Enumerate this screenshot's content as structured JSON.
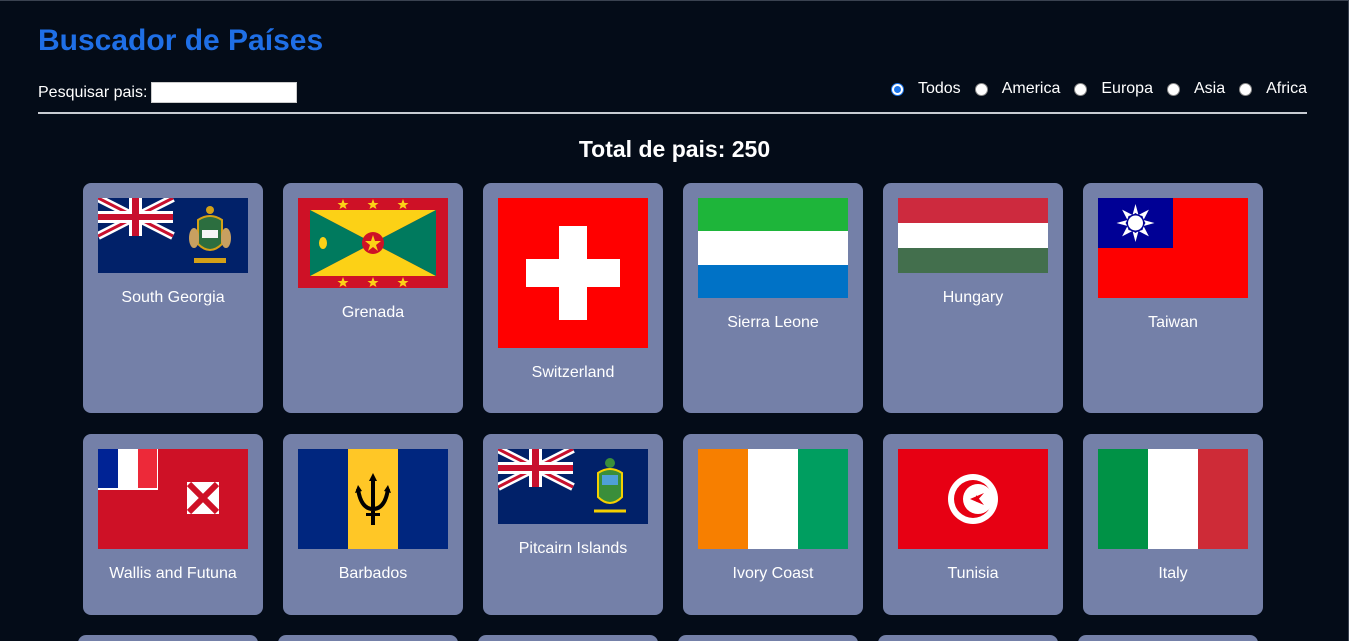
{
  "header": {
    "title": "Buscador de Países"
  },
  "search": {
    "label": "Pesquisar pais:",
    "value": "",
    "placeholder": ""
  },
  "filters": {
    "selected": "Todos",
    "options": [
      "Todos",
      "America",
      "Europa",
      "Asia",
      "Africa"
    ]
  },
  "total": {
    "text": "Total de pais: 250"
  },
  "countries": [
    {
      "name": "South Georgia",
      "flag": "south-georgia-flag-icon"
    },
    {
      "name": "Grenada",
      "flag": "grenada-flag-icon"
    },
    {
      "name": "Switzerland",
      "flag": "switzerland-flag-icon"
    },
    {
      "name": "Sierra Leone",
      "flag": "sierra-leone-flag-icon"
    },
    {
      "name": "Hungary",
      "flag": "hungary-flag-icon"
    },
    {
      "name": "Taiwan",
      "flag": "taiwan-flag-icon"
    },
    {
      "name": "Wallis and Futuna",
      "flag": "wallis-futuna-flag-icon"
    },
    {
      "name": "Barbados",
      "flag": "barbados-flag-icon"
    },
    {
      "name": "Pitcairn Islands",
      "flag": "pitcairn-flag-icon"
    },
    {
      "name": "Ivory Coast",
      "flag": "ivory-coast-flag-icon"
    },
    {
      "name": "Tunisia",
      "flag": "tunisia-flag-icon"
    },
    {
      "name": "Italy",
      "flag": "italy-flag-icon"
    }
  ],
  "colors": {
    "background": "#040c18",
    "title": "#1f6fe6",
    "card": "#7480a8",
    "radio_selected": "#1a73e8"
  }
}
